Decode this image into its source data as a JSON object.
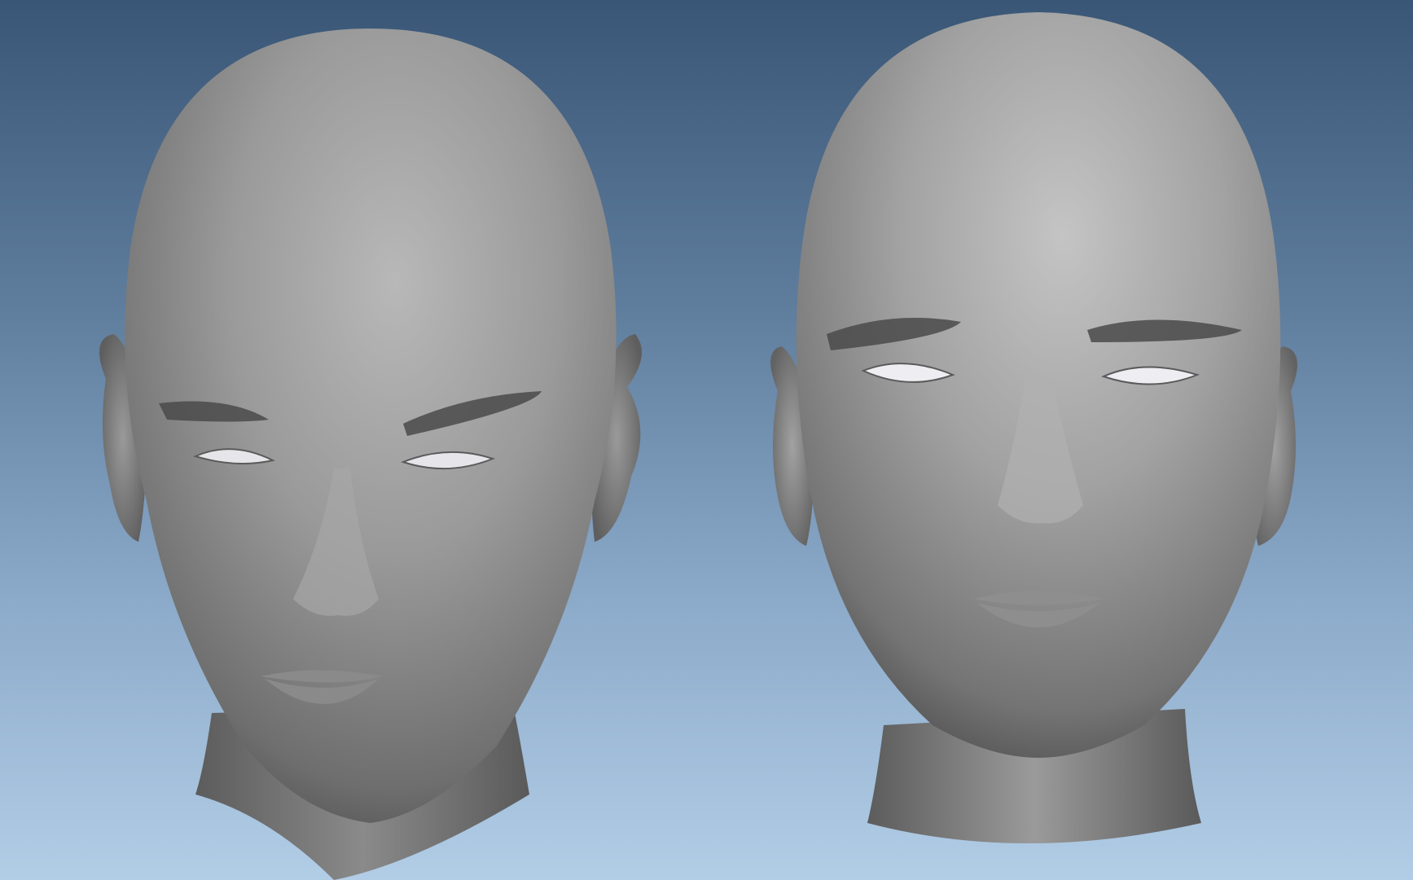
{
  "viewport": {
    "background_top": "#3a5676",
    "background_bottom": "#b2cde6"
  },
  "models": [
    {
      "name": "sculpt-head-left",
      "view": "front-tilted",
      "material": "matcap-gray"
    },
    {
      "name": "sculpt-head-right",
      "view": "front",
      "material": "matcap-gray"
    }
  ]
}
